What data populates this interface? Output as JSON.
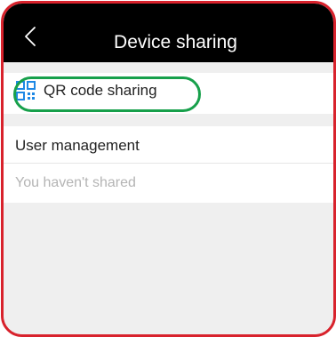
{
  "header": {
    "title": "Device sharing",
    "back_icon": "chevron-left-icon"
  },
  "qr_sharing": {
    "label": "QR code sharing",
    "icon": "qr-code-icon",
    "icon_color": "#1e88e5",
    "highlight_color": "#17a04b"
  },
  "user_management": {
    "label": "User management",
    "empty_text": "You haven't shared"
  },
  "colors": {
    "frame": "#d8222c",
    "titlebar": "#000000",
    "background": "#efefef"
  }
}
